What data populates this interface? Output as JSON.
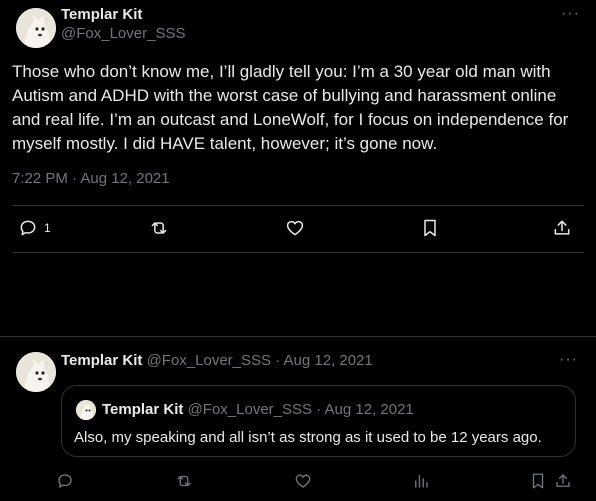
{
  "tweet": {
    "author_name": "Templar Kit",
    "author_handle": "@Fox_Lover_SSS",
    "more_label": "···",
    "body": "Those who don’t know me, I’ll gladly tell you: I’m a 30 year old man with Autism and ADHD with the worst case of bullying and harassment online and real life. I’m an outcast and LoneWolf, for I focus on independence for myself mostly. I did HAVE talent, however; it’s gone now.",
    "timestamp": "7:22 PM · Aug 12, 2021",
    "reply_count": "1",
    "icons": {
      "reply": "reply-icon",
      "retweet": "retweet-icon",
      "like": "heart-icon",
      "bookmark": "bookmark-icon",
      "share": "share-icon"
    }
  },
  "reply": {
    "author_name": "Templar Kit",
    "meta": "@Fox_Lover_SSS · Aug 12, 2021",
    "more_label": "···",
    "quoted": {
      "author_name": "Templar Kit",
      "meta": "@Fox_Lover_SSS · Aug 12, 2021",
      "text": "Also, my speaking and all isn’t as strong as it used to be 12 years ago."
    },
    "icons": [
      "reply-icon",
      "retweet-icon",
      "heart-icon",
      "views-icon",
      "bookmark-icon",
      "share-icon"
    ]
  },
  "colors": {
    "background": "#000000",
    "text": "#e7e9ea",
    "muted": "#71767b",
    "border": "#2f3336"
  }
}
